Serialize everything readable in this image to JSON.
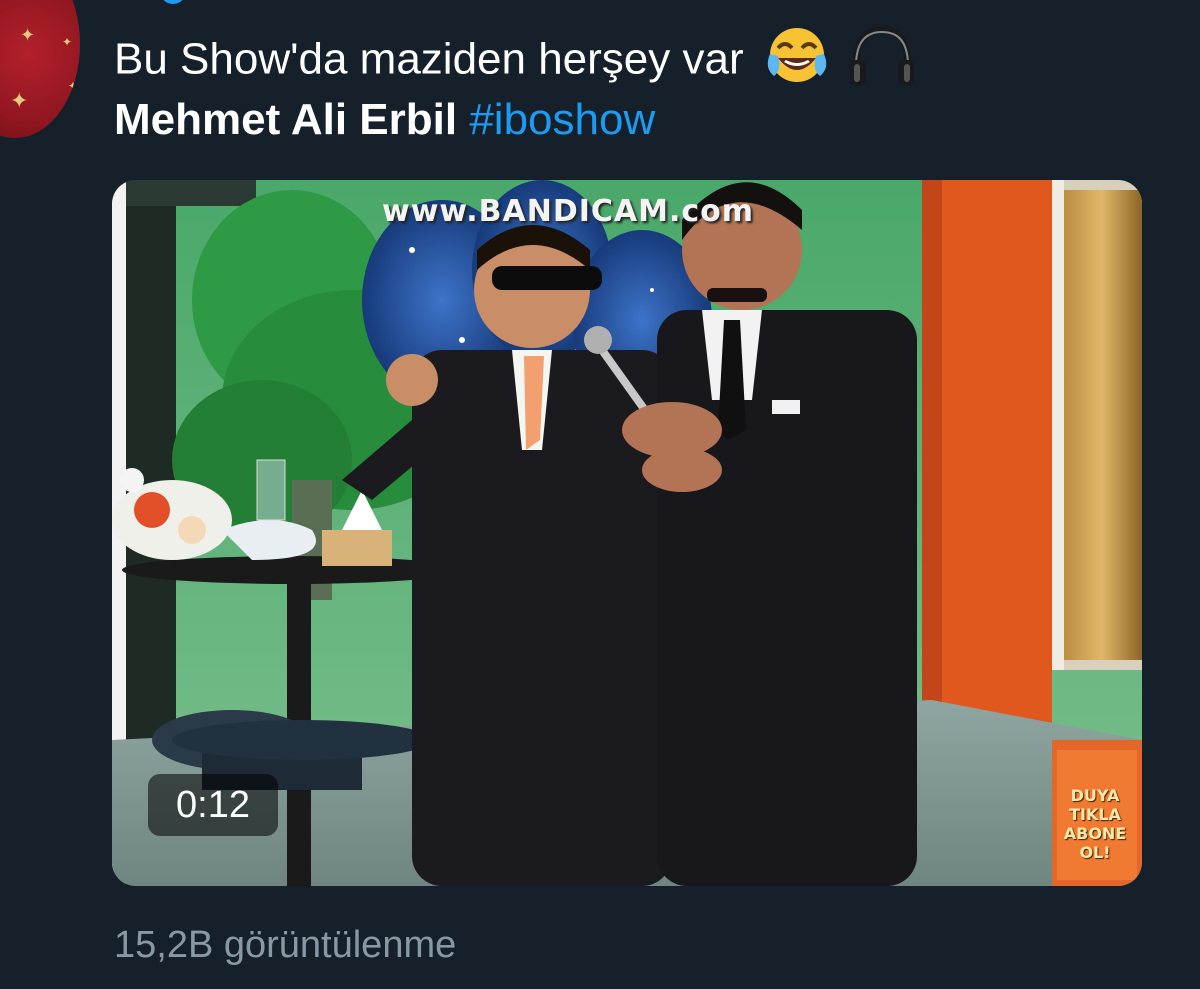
{
  "tweet": {
    "text_line1": "Bu Show'da maziden herşey var",
    "mention_name": "Mehmet Ali Erbil",
    "hashtag": "#iboshow",
    "emojis": [
      "face-with-tears-of-joy-icon",
      "headphones-icon"
    ],
    "hashtag_color": "#1d9bf0"
  },
  "media": {
    "watermark": "www.BANDICAM.com",
    "duration": "0:12",
    "channel_logo_lines": [
      "DUYA",
      "TIKLA",
      "ABONE OL!"
    ]
  },
  "footer": {
    "views": "15,2B görüntülenme"
  },
  "theme": {
    "background": "#15202b",
    "secondary_text": "#8899a6"
  }
}
